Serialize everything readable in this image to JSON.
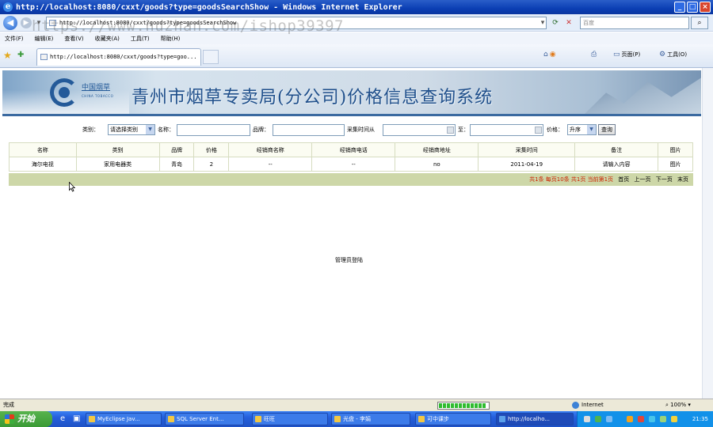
{
  "window": {
    "title": "http://localhost:8080/cxxt/goods?type=goodsSearchShow - Windows Internet Explorer",
    "buttons": [
      "_",
      "□",
      "×"
    ]
  },
  "address": {
    "url": "http://localhost:8080/cxxt/goods?type=goodsSearchShow",
    "search_placeholder": "百度"
  },
  "menu": [
    "文件(F)",
    "编辑(E)",
    "查看(V)",
    "收藏夹(A)",
    "工具(T)",
    "帮助(H)"
  ],
  "tab": {
    "label": "http://localhost:8080/cxxt/goods?type=goo..."
  },
  "commands": {
    "page": "页面(P)",
    "tools": "工具(O)"
  },
  "watermark": "https://www.huzhan.com/ishop39397",
  "banner": {
    "logo_text": "中国烟草",
    "logo_sub": "CHINA TOBACCO",
    "title": "青州市烟草专卖局(分公司)价格信息查询系统"
  },
  "filter": {
    "category_label": "类别：",
    "category_value": "请选择类别",
    "name_label": "名称：",
    "brand_label": "品牌：",
    "time_from_label": "采集时间从",
    "time_to_label": "至：",
    "price_label": "价格：",
    "price_order": "升序",
    "query_button": "查询"
  },
  "table": {
    "headers": [
      "名称",
      "类别",
      "品牌",
      "价格",
      "经销商名称",
      "经销商电话",
      "经销商地址",
      "采集时间",
      "备注",
      "图片"
    ],
    "rows": [
      [
        "海尔电视",
        "家用电器类",
        "青岛",
        "2",
        "--",
        "--",
        "no",
        "2011-04-19",
        "请输入内容",
        "图片"
      ]
    ]
  },
  "pager": {
    "summary": "共1条 每页10条 共1页 当前第1页",
    "first": "首页",
    "prev": "上一页",
    "next": "下一页",
    "last": "末页"
  },
  "admin_link": "管理员登陆",
  "statusbar": {
    "status": "完成",
    "zone": "Internet",
    "zoom": "100%"
  },
  "taskbar": {
    "start": "开始",
    "tasks": [
      "MyEclipse Jav...",
      "SQL Server Ent...",
      "旺旺",
      "光盘 - 李娟",
      "可中课步",
      "http://localho..."
    ],
    "clock": "21:35"
  },
  "colors": {
    "titlebar": "#0b3fb4",
    "banner_title": "#1f4f8b",
    "pager_bg": "#cdd7a8",
    "pager_red": "#cc2200"
  }
}
